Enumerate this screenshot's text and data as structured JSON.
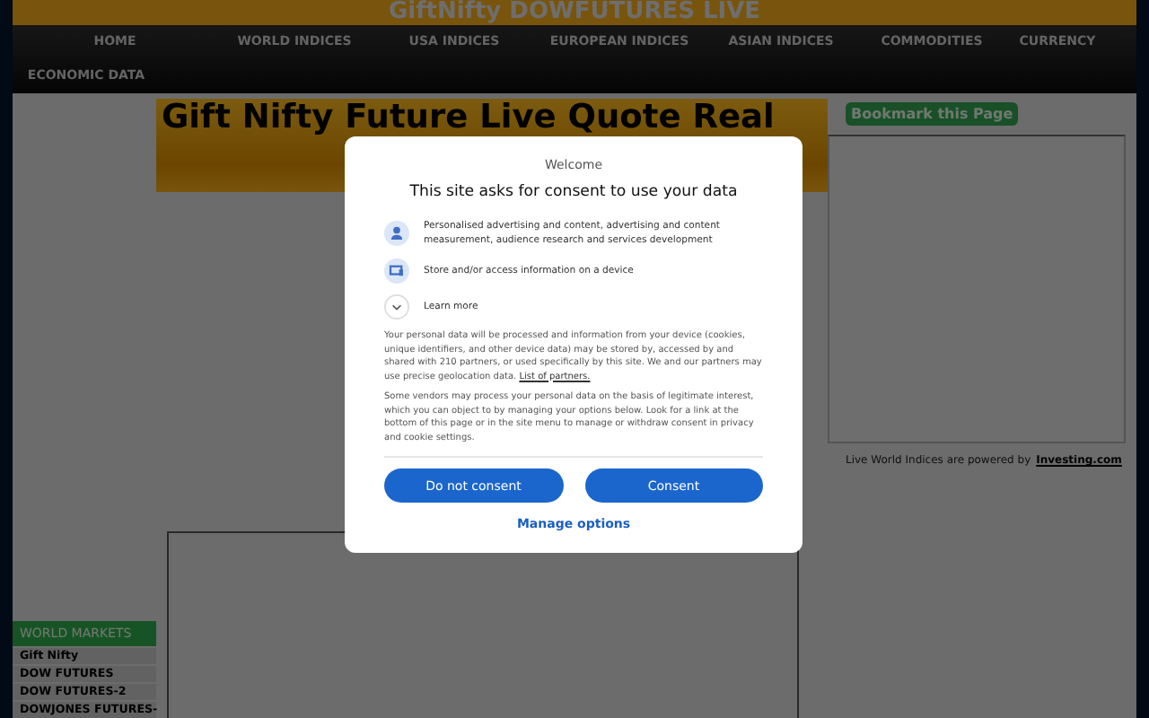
{
  "site_title": "GiftNifty DOWFUTURES LIVE",
  "nav": [
    {
      "label": "HOME"
    },
    {
      "label": "WORLD INDICES"
    },
    {
      "label": "USA INDICES"
    },
    {
      "label": "EUROPEAN INDICES"
    },
    {
      "label": "ASIAN INDICES"
    },
    {
      "label": "COMMODITIES"
    },
    {
      "label": "CURRENCY"
    },
    {
      "label": "ECONOMIC DATA"
    }
  ],
  "headline": "Gift Nifty Future Live Quote Real",
  "bookmark_button": "Bookmark this Page",
  "powered_by": {
    "text": "Live World Indices are powered by",
    "link": "Investing.com"
  },
  "sidebar": {
    "title": "WORLD MARKETS",
    "items": [
      {
        "label": "Gift Nifty"
      },
      {
        "label": "DOW FUTURES"
      },
      {
        "label": "DOW FUTURES-2"
      },
      {
        "label": "DOWJONES FUTURES-"
      }
    ]
  },
  "consent_dialog": {
    "welcome": "Welcome",
    "title": "This site asks for consent to use your data",
    "purposes": [
      {
        "kind": "person",
        "text": "Personalised advertising and content, advertising and content measurement, audience research and services development"
      },
      {
        "kind": "device",
        "text": "Store and/or access information on a device"
      },
      {
        "kind": "expand",
        "text": "Learn more"
      }
    ],
    "paragraph_1": {
      "text": "Your personal data will be processed and information from your device (cookies, unique identifiers, and other device data) may be stored by, accessed by and shared with 210 partners, or used specifically by this site. We and our partners may use precise geolocation data.",
      "link": "List of partners."
    },
    "paragraph_2": "Some vendors may process your personal data on the basis of legitimate interest, which you can object to by managing your options below. Look for a link at the bottom of this page or in the site menu to manage or withdraw consent in privacy and cookie settings.",
    "buttons": [
      "Do not consent",
      "Consent"
    ],
    "manage_link": "Manage options"
  }
}
